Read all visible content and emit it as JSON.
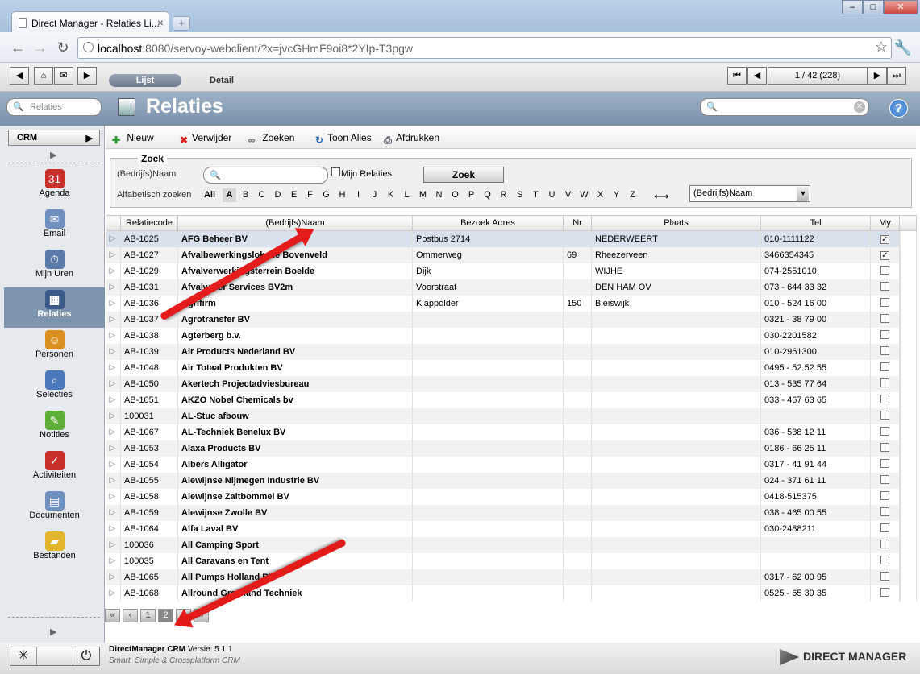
{
  "browser": {
    "tab_title": "Direct Manager - Relaties Li...",
    "url_host": "localhost",
    "url_rest": ":8080/servoy-webclient/?x=jvcGHmF9oi8*2YIp-T3pgw"
  },
  "topbar": {
    "view_tabs": [
      "Lijst",
      "Detail"
    ],
    "record_counter": "1 / 42 (228)"
  },
  "header": {
    "search_placeholder": "Relaties",
    "title": "Relaties",
    "help": "?"
  },
  "sidebar": {
    "module": "CRM",
    "items": [
      {
        "label": "Agenda",
        "icon": "calendar-icon",
        "color": "#c9302c"
      },
      {
        "label": "Email",
        "icon": "envelope-icon",
        "color": "#6f8fbf"
      },
      {
        "label": "Mijn Uren",
        "icon": "stopwatch-icon",
        "color": "#5a7aa8"
      },
      {
        "label": "Relaties",
        "icon": "building-icon",
        "color": "#3c5a88"
      },
      {
        "label": "Personen",
        "icon": "people-icon",
        "color": "#d9901e"
      },
      {
        "label": "Selecties",
        "icon": "magnifier-icon",
        "color": "#4a78b8"
      },
      {
        "label": "Notities",
        "icon": "note-icon",
        "color": "#5fae3a"
      },
      {
        "label": "Activiteiten",
        "icon": "calendar-check-icon",
        "color": "#c9302c"
      },
      {
        "label": "Documenten",
        "icon": "document-icon",
        "color": "#6f8fbf"
      },
      {
        "label": "Bestanden",
        "icon": "folder-icon",
        "color": "#e1b52c"
      }
    ]
  },
  "toolbar": {
    "new": "Nieuw",
    "delete": "Verwijder",
    "search": "Zoeken",
    "show_all": "Toon Alles",
    "print": "Afdrukken"
  },
  "zoek": {
    "legend": "Zoek",
    "name_label": "(Bedrijfs)Naam",
    "my_relations": "Mijn Relaties",
    "button": "Zoek",
    "alpha_label": "Alfabetisch zoeken",
    "letters": [
      "All",
      "A",
      "B",
      "C",
      "D",
      "E",
      "F",
      "G",
      "H",
      "I",
      "J",
      "K",
      "L",
      "M",
      "N",
      "O",
      "P",
      "Q",
      "R",
      "S",
      "T",
      "U",
      "V",
      "W",
      "X",
      "Y",
      "Z"
    ],
    "field_select": "(Bedrijfs)Naam"
  },
  "table": {
    "headers": [
      "Relatiecode",
      "(Bedrijfs)Naam",
      "Bezoek Adres",
      "Nr",
      "Plaats",
      "Tel",
      "My"
    ],
    "rows": [
      {
        "code": "AB-1025",
        "name": "AFG Beheer BV",
        "adres": "Postbus 2714",
        "nr": "",
        "plaats": "NEDERWEERT",
        "tel": "010-1111122",
        "my": "✓"
      },
      {
        "code": "AB-1027",
        "name": "Afvalbewerkingslokatie Bovenveld",
        "adres": "Ommerweg",
        "nr": "69",
        "plaats": "Rheezerveen",
        "tel": "3466354345",
        "my": "✓"
      },
      {
        "code": "AB-1029",
        "name": "Afvalverwerkingsterrein Boelde",
        "adres": "Dijk",
        "nr": "",
        "plaats": "WIJHE",
        "tel": "074-2551010",
        "my": ""
      },
      {
        "code": "AB-1031",
        "name": "Afvalwater Services BV2m",
        "adres": "Voorstraat",
        "nr": "",
        "plaats": "DEN HAM OV",
        "tel": "073 - 644 33 32",
        "my": ""
      },
      {
        "code": "AB-1036",
        "name": "Agrifirm",
        "adres": "Klappolder",
        "nr": "150",
        "plaats": "Bleiswijk",
        "tel": "010 - 524 16 00",
        "my": ""
      },
      {
        "code": "AB-1037",
        "name": "Agrotransfer BV",
        "adres": "",
        "nr": "",
        "plaats": "",
        "tel": "0321 - 38 79 00",
        "my": ""
      },
      {
        "code": "AB-1038",
        "name": "Agterberg b.v.",
        "adres": "",
        "nr": "",
        "plaats": "",
        "tel": "030-2201582",
        "my": ""
      },
      {
        "code": "AB-1039",
        "name": "Air Products Nederland BV",
        "adres": "",
        "nr": "",
        "plaats": "",
        "tel": "010-2961300",
        "my": ""
      },
      {
        "code": "AB-1048",
        "name": "Air Totaal Produkten BV",
        "adres": "",
        "nr": "",
        "plaats": "",
        "tel": "0495 - 52 52 55",
        "my": ""
      },
      {
        "code": "AB-1050",
        "name": "Akertech Projectadviesbureau",
        "adres": "",
        "nr": "",
        "plaats": "",
        "tel": "013 - 535 77 64",
        "my": ""
      },
      {
        "code": "AB-1051",
        "name": "AKZO Nobel Chemicals bv",
        "adres": "",
        "nr": "",
        "plaats": "",
        "tel": "033 - 467 63 65",
        "my": ""
      },
      {
        "code": "100031",
        "name": "AL-Stuc afbouw",
        "adres": "",
        "nr": "",
        "plaats": "",
        "tel": "",
        "my": ""
      },
      {
        "code": "AB-1067",
        "name": "AL-Techniek Benelux BV",
        "adres": "",
        "nr": "",
        "plaats": "",
        "tel": "036 - 538 12 11",
        "my": ""
      },
      {
        "code": "AB-1053",
        "name": "Alaxa Products BV",
        "adres": "",
        "nr": "",
        "plaats": "",
        "tel": "0186 - 66 25 11",
        "my": ""
      },
      {
        "code": "AB-1054",
        "name": "Albers Alligator",
        "adres": "",
        "nr": "",
        "plaats": "",
        "tel": "0317 - 41 91 44",
        "my": ""
      },
      {
        "code": "AB-1055",
        "name": "Alewijnse Nijmegen Industrie BV",
        "adres": "",
        "nr": "",
        "plaats": "",
        "tel": "024 - 371 61 11",
        "my": ""
      },
      {
        "code": "AB-1058",
        "name": "Alewijnse Zaltbommel BV",
        "adres": "",
        "nr": "",
        "plaats": "",
        "tel": "0418-515375",
        "my": ""
      },
      {
        "code": "AB-1059",
        "name": "Alewijnse Zwolle BV",
        "adres": "",
        "nr": "",
        "plaats": "",
        "tel": "038 - 465 00 55",
        "my": ""
      },
      {
        "code": "AB-1064",
        "name": "Alfa Laval  BV",
        "adres": "",
        "nr": "",
        "plaats": "",
        "tel": "030-2488211",
        "my": ""
      },
      {
        "code": "100036",
        "name": "All Camping Sport",
        "adres": "",
        "nr": "",
        "plaats": "",
        "tel": "",
        "my": ""
      },
      {
        "code": "100035",
        "name": "All Caravans en Tent",
        "adres": "",
        "nr": "",
        "plaats": "",
        "tel": "",
        "my": ""
      },
      {
        "code": "AB-1065",
        "name": "All Pumps Holland BV",
        "adres": "",
        "nr": "",
        "plaats": "",
        "tel": "0317 - 62 00 95",
        "my": ""
      },
      {
        "code": "AB-1068",
        "name": "Allround Graafland Techniek",
        "adres": "",
        "nr": "",
        "plaats": "",
        "tel": "0525 - 65 39 35",
        "my": ""
      }
    ]
  },
  "pager": {
    "first": "«",
    "prev": "‹",
    "pages": [
      "1",
      "2"
    ],
    "next": "›",
    "last": "»"
  },
  "footer": {
    "product": "DirectManager CRM",
    "version": "Versie: 5.1.1",
    "tagline": "Smart, Simple & Crossplatform CRM",
    "logo": "DIRECT MANAGER"
  }
}
